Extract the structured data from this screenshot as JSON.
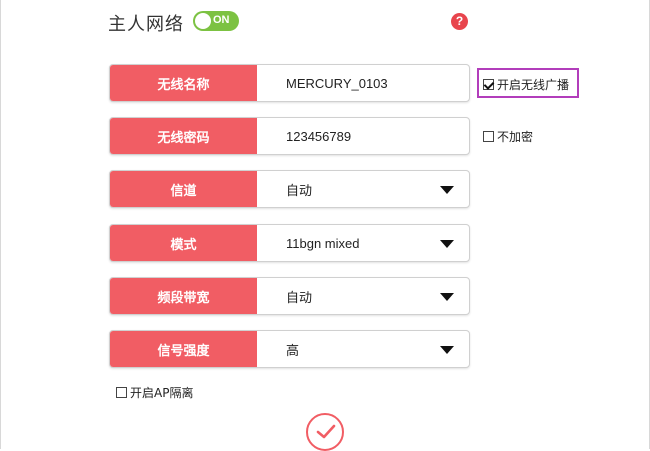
{
  "header": {
    "title": "主人网络",
    "toggle_label": "ON",
    "help_symbol": "?"
  },
  "form": {
    "rows": [
      {
        "label": "无线名称",
        "value": "MERCURY_0103",
        "type": "text"
      },
      {
        "label": "无线密码",
        "value": "123456789",
        "type": "text"
      },
      {
        "label": "信道",
        "value": "自动",
        "type": "select"
      },
      {
        "label": "模式",
        "value": "11bgn mixed",
        "type": "select"
      },
      {
        "label": "频段带宽",
        "value": "自动",
        "type": "select"
      },
      {
        "label": "信号强度",
        "value": "高",
        "type": "select"
      }
    ],
    "broadcast_checkbox": {
      "label": "开启无线广播",
      "checked": true
    },
    "no_encrypt_checkbox": {
      "label": "不加密",
      "checked": false
    },
    "ap_isolation_checkbox": {
      "label": "开启AP隔离",
      "checked": false
    }
  },
  "colors": {
    "accent": "#f15d64",
    "toggle_on": "#7cc242",
    "highlight": "#b23dbb",
    "help": "#e8454d"
  },
  "icons": {
    "help": "help-icon",
    "dropdown": "chevron-down-icon",
    "confirm": "checkmark-icon"
  }
}
